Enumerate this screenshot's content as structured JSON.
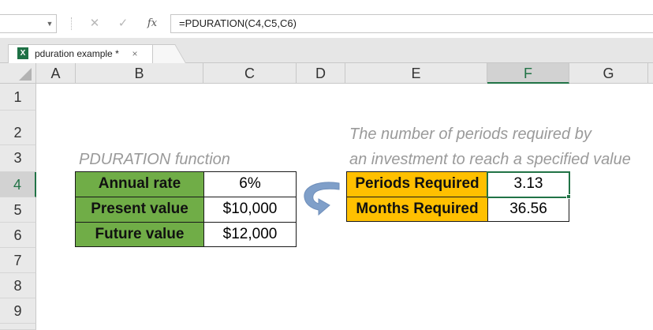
{
  "formula_bar": {
    "name_box": "",
    "formula": "=PDURATION(C4,C5,C6)",
    "cancel_icon": "✕",
    "enter_icon": "✓",
    "fx_icon": "fx"
  },
  "tabs": {
    "sheet_name": "pduration example *",
    "close_icon": "×",
    "excel_icon": "X"
  },
  "grid": {
    "columns": [
      "A",
      "B",
      "C",
      "D",
      "E",
      "F",
      "G"
    ],
    "rows": [
      "1",
      "2",
      "3",
      "4",
      "5",
      "6",
      "7",
      "8",
      "9"
    ],
    "active_cell": "F4"
  },
  "content": {
    "left_title": "PDURATION function",
    "inputs": [
      {
        "label": "Annual rate",
        "value": "6%"
      },
      {
        "label": "Present value",
        "value": "$10,000"
      },
      {
        "label": "Future value",
        "value": "$12,000"
      }
    ],
    "note_line1": "The number of periods required by",
    "note_line2": "an investment to reach a specified value",
    "results": [
      {
        "label": "Periods Required",
        "value": "3.13"
      },
      {
        "label": "Months Required",
        "value": "36.56"
      }
    ]
  },
  "colors": {
    "input_label_fill": "#70ad47",
    "result_label_fill": "#ffc000",
    "selection": "#217346",
    "arrow": "#7f9fc9"
  }
}
